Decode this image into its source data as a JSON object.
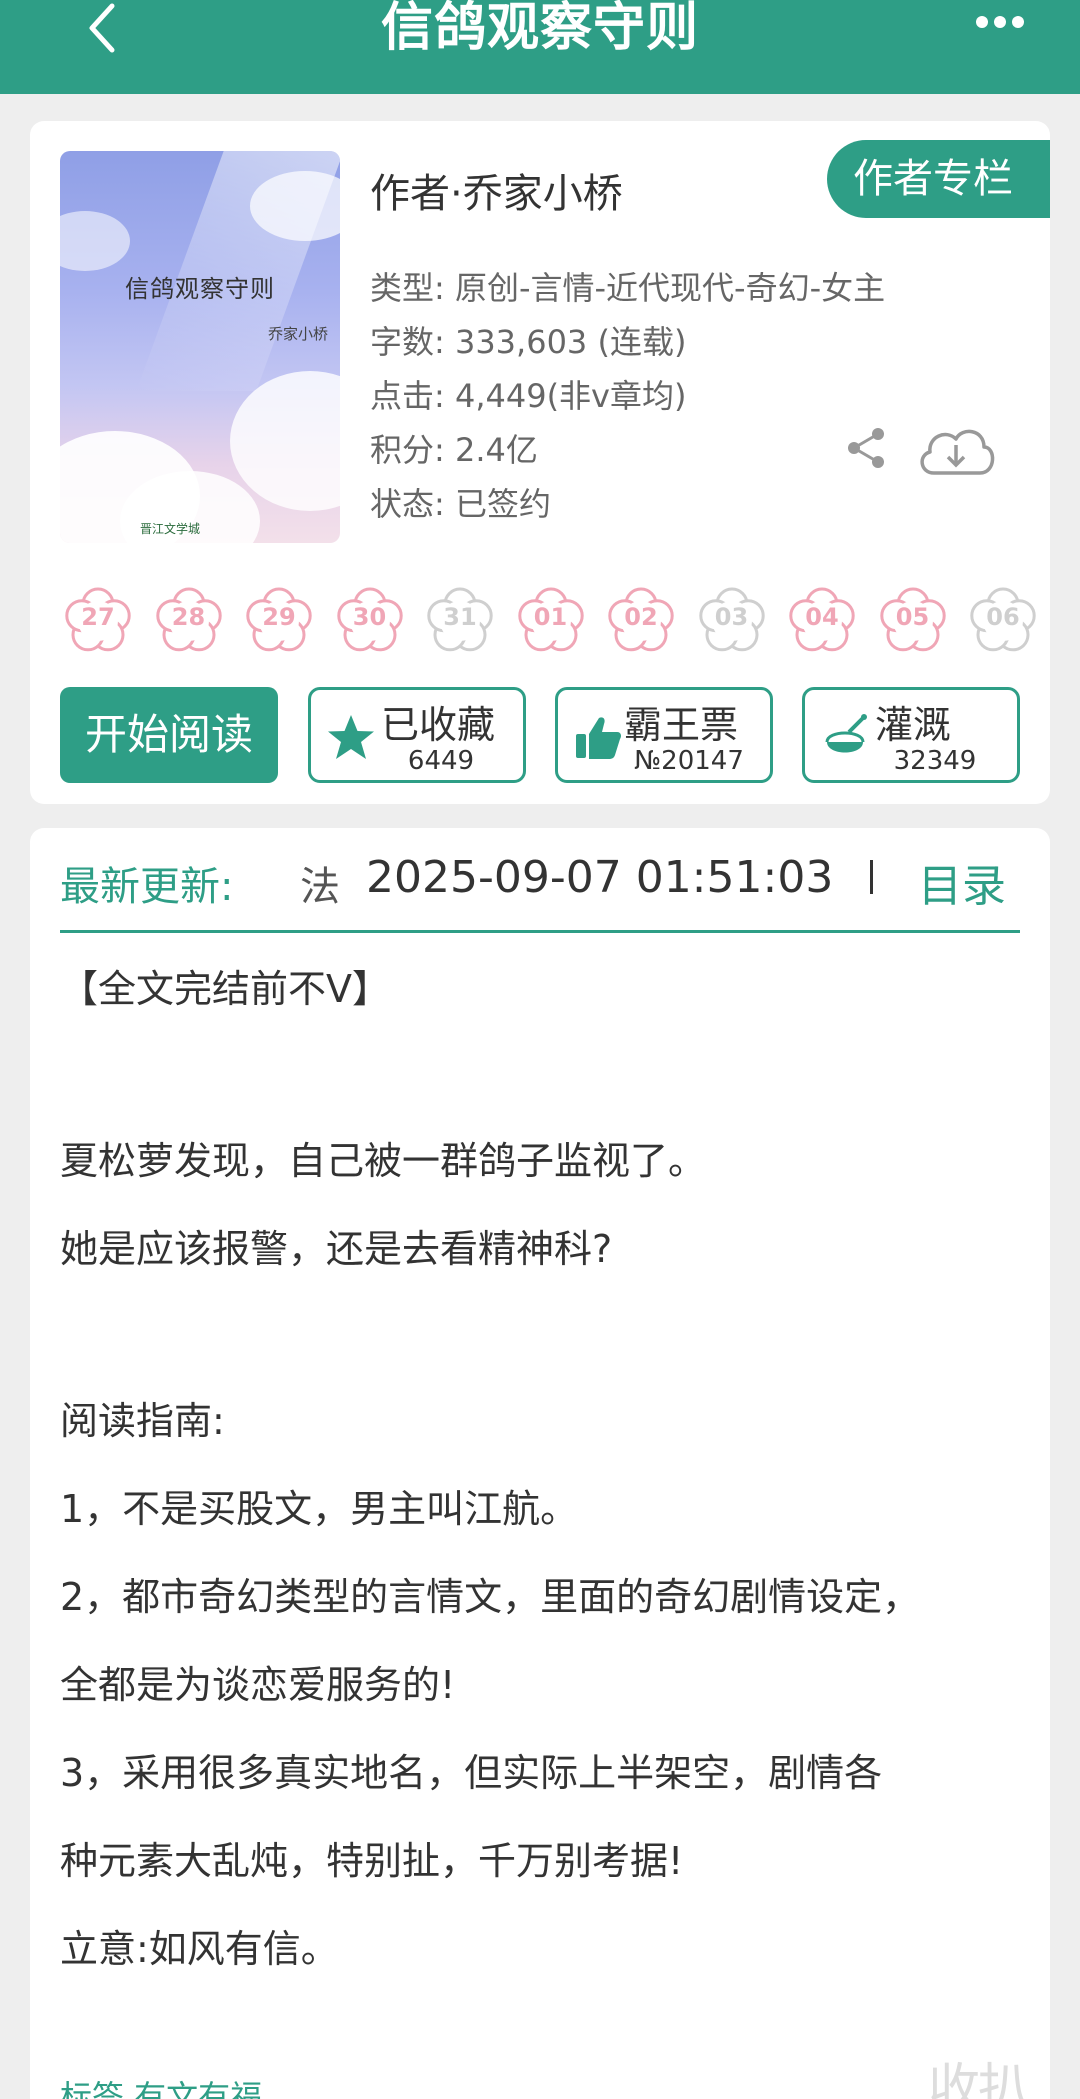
{
  "header": {
    "title": "信鸽观察守则"
  },
  "book": {
    "cover_title": "信鸽观察守则",
    "cover_author": "乔家小桥",
    "cover_logo": "晋江文学城",
    "author_line": "作者·乔家小桥",
    "author_column_label": "作者专栏",
    "genre": "类型: 原创-言情-近代现代-奇幻-女主",
    "word_count": "字数: 333,603 (连载)",
    "clicks": "点击: 4,449(非v章均)",
    "points": "积分: 2.4亿",
    "status": "状态: 已签约"
  },
  "calendar": {
    "days": [
      {
        "num": "27",
        "active": true
      },
      {
        "num": "28",
        "active": true
      },
      {
        "num": "29",
        "active": true
      },
      {
        "num": "30",
        "active": true
      },
      {
        "num": "31",
        "active": false
      },
      {
        "num": "01",
        "active": true
      },
      {
        "num": "02",
        "active": true
      },
      {
        "num": "03",
        "active": false
      },
      {
        "num": "04",
        "active": true
      },
      {
        "num": "05",
        "active": true
      },
      {
        "num": "06",
        "active": false
      }
    ],
    "active_color": "#f0a6b6",
    "inactive_color": "#cfcfcf"
  },
  "actions": {
    "start_reading": "开始阅读",
    "favorite": {
      "label": "已收藏",
      "count": "6449"
    },
    "bawang": {
      "label": "霸王票",
      "count": "№20147"
    },
    "irrigate": {
      "label": "灌溉",
      "count": "32349"
    }
  },
  "update": {
    "label": "最新更新:",
    "chapter_char": "法",
    "time": "2025-09-07 01:51:03",
    "toc": "目录"
  },
  "summary": {
    "lines": [
      "【全文完结前不V】",
      "夏松萝发现，自己被一群鸽子监视了。",
      "她是应该报警，还是去看精神科?",
      "阅读指南:",
      "1，不是买股文，男主叫江航。",
      "2，都市奇幻类型的言情文，里面的奇幻剧情设定，",
      "全都是为谈恋爱服务的!",
      "3，采用很多真实地名，但实际上半架空，剧情各",
      "种元素大乱炖，特别扯，千万别考据!",
      "立意:如风有信。"
    ],
    "tags_cut": "标签 有文有福",
    "watermark": "收扒"
  },
  "colors": {
    "accent": "#2e9e86",
    "page_bg": "#eeeeee"
  }
}
